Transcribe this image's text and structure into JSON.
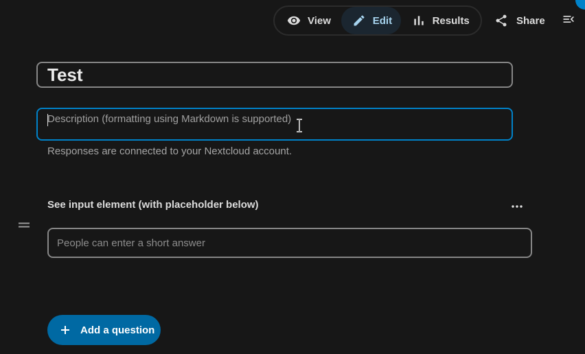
{
  "toolbar": {
    "modes": {
      "view": {
        "label": "View",
        "icon": "eye-icon"
      },
      "edit": {
        "label": "Edit",
        "icon": "pencil-icon",
        "active": true
      },
      "results": {
        "label": "Results",
        "icon": "bar-chart-icon"
      }
    },
    "share": {
      "label": "Share",
      "icon": "share-icon"
    },
    "sidebar_toggle": {
      "icon": "menu-open-icon"
    }
  },
  "form": {
    "title": "Test",
    "description": {
      "value": "",
      "placeholder": "Description (formatting using Markdown is supported)"
    },
    "info": "Responses are connected to your Nextcloud account."
  },
  "question": {
    "title": "See input element (with placeholder below)",
    "answer_placeholder": "People can enter a short answer",
    "menu_icon": "more-horizontal-icon",
    "drag_icon": "drag-handle-icon"
  },
  "add_question": {
    "label": "Add a question",
    "icon": "plus-icon"
  },
  "colors": {
    "background": "#171717",
    "accent": "#0082c9",
    "primary_button": "#0069a3",
    "active_mode_bg": "#1b2630",
    "active_mode_text": "#a7d4ef"
  }
}
